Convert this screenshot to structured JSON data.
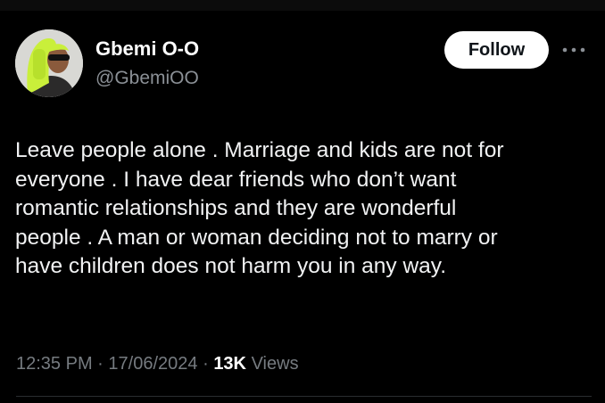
{
  "author": {
    "display_name": "Gbemi O-O",
    "handle": "@GbemiOO",
    "avatar_icon": "avatar-icon"
  },
  "actions": {
    "follow_label": "Follow",
    "more_icon": "more-options-icon"
  },
  "tweet": {
    "lines": [
      "Leave people alone . Marriage and kids are not for",
      "everyone . I have dear friends who don’t want",
      "romantic relationships and they are wonderful",
      "people . A man or woman deciding not to marry or",
      "have children does not harm you in any way."
    ],
    "time": "12:35 PM",
    "separator": "·",
    "date": "17/06/2024",
    "views_count": "13K",
    "views_label": "Views"
  },
  "colors": {
    "background": "#000000",
    "text": "#e7e9ea",
    "muted": "#767b80",
    "button_bg": "#ffffff"
  }
}
